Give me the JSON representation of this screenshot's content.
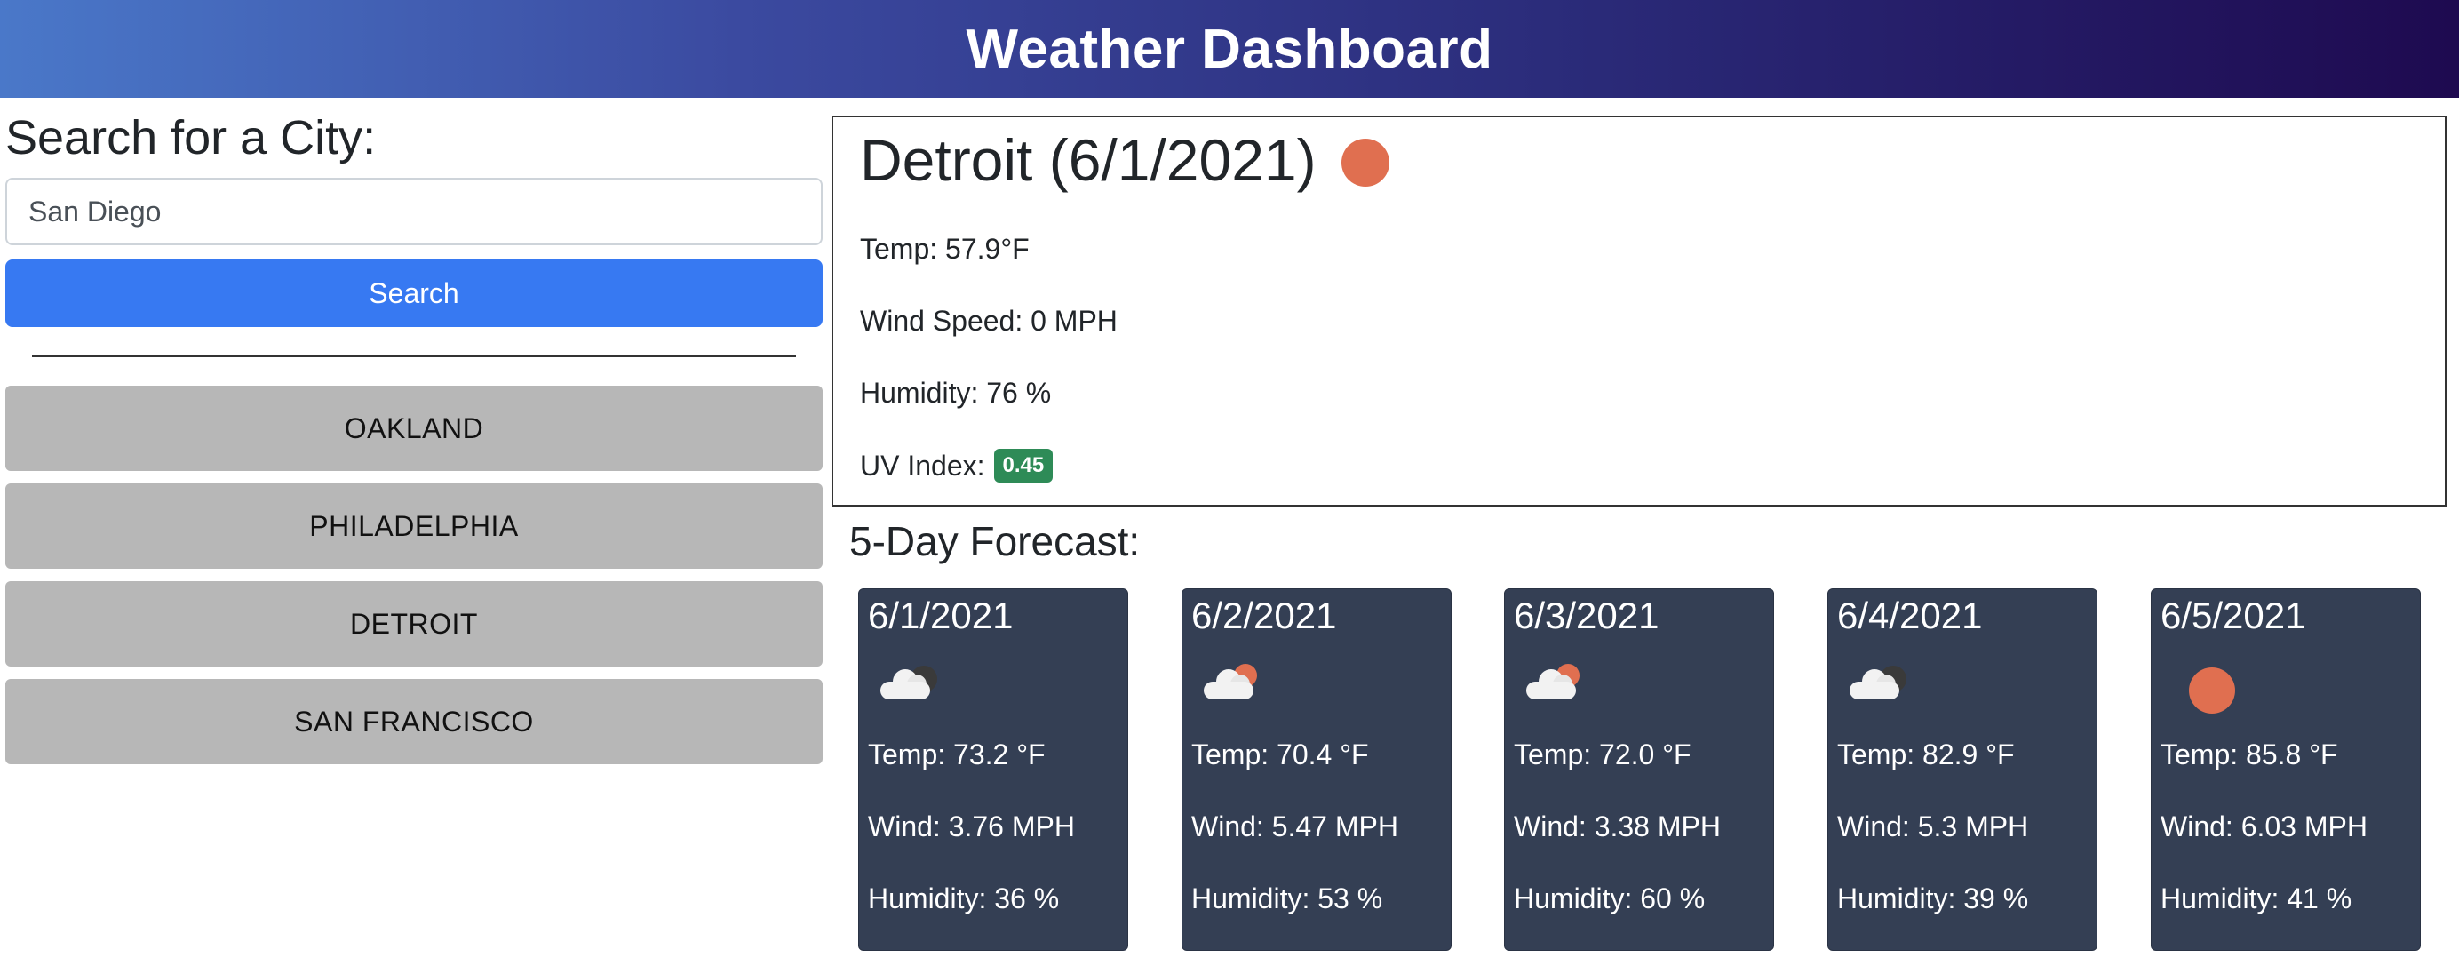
{
  "header": {
    "title": "Weather Dashboard"
  },
  "search": {
    "title": "Search for a City:",
    "input_value": "San Diego",
    "button_label": "Search"
  },
  "history": [
    {
      "label": "OAKLAND"
    },
    {
      "label": "PHILADELPHIA"
    },
    {
      "label": "DETROIT"
    },
    {
      "label": "SAN FRANCISCO"
    }
  ],
  "current": {
    "title": "Detroit (6/1/2021)",
    "icon": "sun-icon",
    "temp": "Temp: 57.9°F",
    "wind": "Wind Speed: 0 MPH",
    "humidity": "Humidity: 76 %",
    "uv_label": "UV Index:",
    "uv_value": "0.45",
    "uv_color": "#2e8b57"
  },
  "forecast": {
    "title": "5-Day Forecast:",
    "days": [
      {
        "date": "6/1/2021",
        "icon": "cloud-icon",
        "temp": "Temp: 73.2 °F",
        "wind": "Wind: 3.76 MPH",
        "humidity": "Humidity: 36 %"
      },
      {
        "date": "6/2/2021",
        "icon": "partly-cloudy-icon",
        "temp": "Temp: 70.4 °F",
        "wind": "Wind: 5.47 MPH",
        "humidity": "Humidity: 53 %"
      },
      {
        "date": "6/3/2021",
        "icon": "partly-cloudy-icon",
        "temp": "Temp: 72.0 °F",
        "wind": "Wind: 3.38 MPH",
        "humidity": "Humidity: 60 %"
      },
      {
        "date": "6/4/2021",
        "icon": "cloud-icon",
        "temp": "Temp: 82.9 °F",
        "wind": "Wind: 5.3 MPH",
        "humidity": "Humidity: 39 %"
      },
      {
        "date": "6/5/2021",
        "icon": "sun-icon",
        "temp": "Temp: 85.8 °F",
        "wind": "Wind: 6.03 MPH",
        "humidity": "Humidity: 41 %"
      }
    ]
  },
  "colors": {
    "accent_button": "#3779f2",
    "history_button": "#b7b7b7",
    "card_bg": "#343f54",
    "sun": "#e06f50"
  }
}
